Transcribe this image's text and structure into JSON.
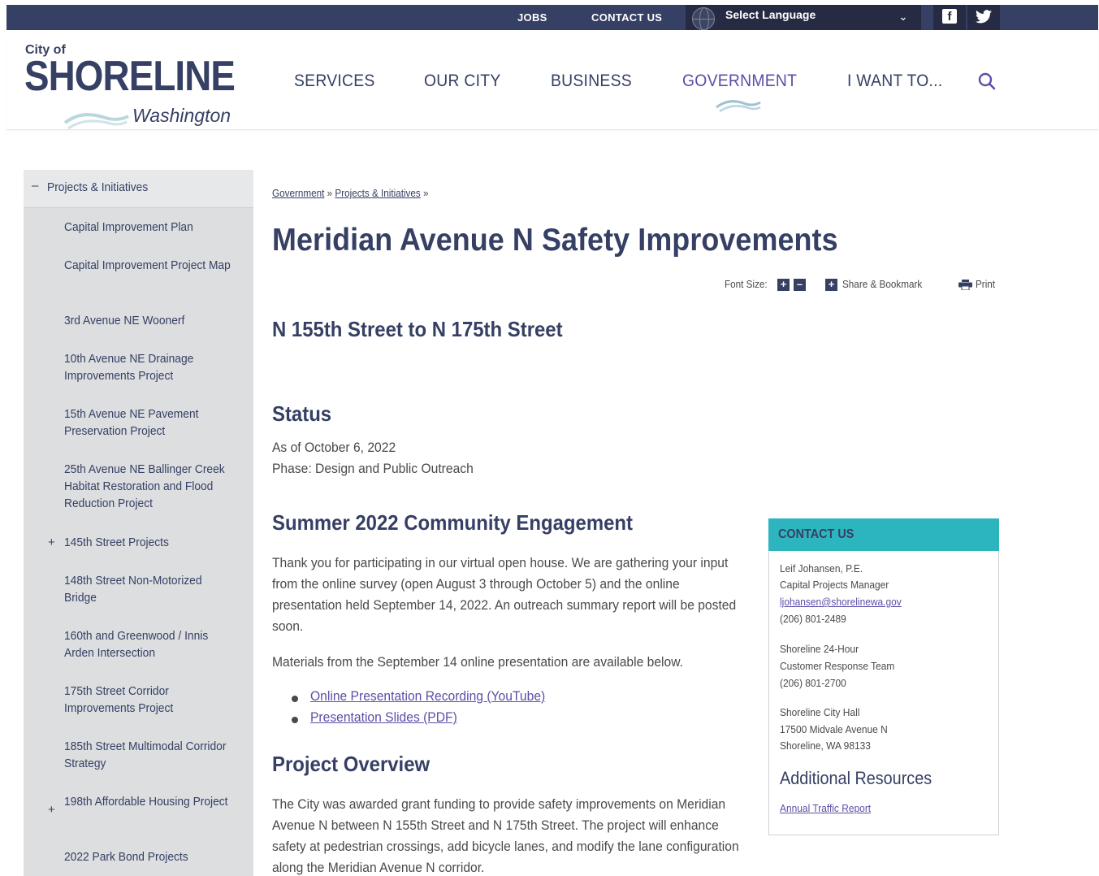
{
  "topbar": {
    "jobs": "JOBS",
    "contact": "CONTACT US",
    "language": "Select Language",
    "facebook": "f",
    "twitter": "t"
  },
  "logo": {
    "city_of": "City of",
    "name": "SHORELINE",
    "state": "Washington"
  },
  "nav": {
    "items": [
      "SERVICES",
      "OUR CITY",
      "BUSINESS",
      "GOVERNMENT",
      "I WANT TO..."
    ],
    "active_color": "#5c4ea8"
  },
  "sidebar": {
    "heading": "Projects & Initiatives",
    "items": [
      "Capital Improvement Plan",
      "Capital Improvement Project Map",
      "3rd Avenue NE Woonerf",
      "10th Avenue NE Drainage Improvements Project",
      "15th Avenue NE Pavement Preservation Project",
      "25th Avenue NE Ballinger Creek Habitat Restoration and Flood Reduction Project",
      "145th Street Projects",
      "148th Street Non-Motorized Bridge",
      "160th and Greenwood / Innis Arden Intersection",
      "175th Street Corridor Improvements Project",
      "185th Street Multimodal Corridor Strategy",
      "198th Affordable Housing Project",
      "2022 Park Bond Projects"
    ]
  },
  "breadcrumb": {
    "items": [
      "Government",
      "Projects & Initiatives"
    ],
    "sep": "»"
  },
  "page": {
    "title": "Meridian Avenue N Safety Improvements",
    "font_size_label": "Font Size:",
    "share_label": "Share & Bookmark",
    "print_label": "Print",
    "subtitle": "N 155th Street to N 175th Street",
    "status_heading": "Status",
    "status_date": "As of October 6, 2022",
    "status_phase": "Phase: Design and Public Outreach",
    "engagement_heading": "Summer 2022 Community Engagement",
    "engagement_text": "Thank you for participating in our virtual open house. We are gathering your input from the online survey (open August 3 through October 5) and the online presentation held September 14, 2022. An outreach summary report will be posted soon.",
    "materials_text": "Materials from the September 14 online presentation are available below.",
    "links": [
      "Online Presentation Recording (YouTube)",
      "Presentation Slides (PDF)"
    ],
    "overview_heading": "Project Overview",
    "overview_text": "The City was awarded grant funding to provide safety improvements on Meridian Avenue N between N 155th Street and N 175th Street. The project will enhance safety at pedestrian crossings, add bicycle lanes, and modify the lane configuration along the Meridian Avenue N corridor."
  },
  "contact": {
    "heading": "CONTACT US",
    "name": "Leif Johansen, P.E.",
    "role": "Capital Projects Manager",
    "email": "ljohansen@shorelinewa.gov",
    "phone": "(206) 801-2489",
    "team_line1": "Shoreline 24-Hour",
    "team_line2": "Customer Response Team",
    "team_phone": "(206) 801-2700",
    "hall_line1": "Shoreline City Hall",
    "hall_line2": "17500 Midvale Avenue N",
    "hall_line3": "Shoreline, WA 98133",
    "resources_heading": "Additional Resources",
    "resource_link": "Annual Traffic Report",
    "accent": "#2db5bf"
  }
}
